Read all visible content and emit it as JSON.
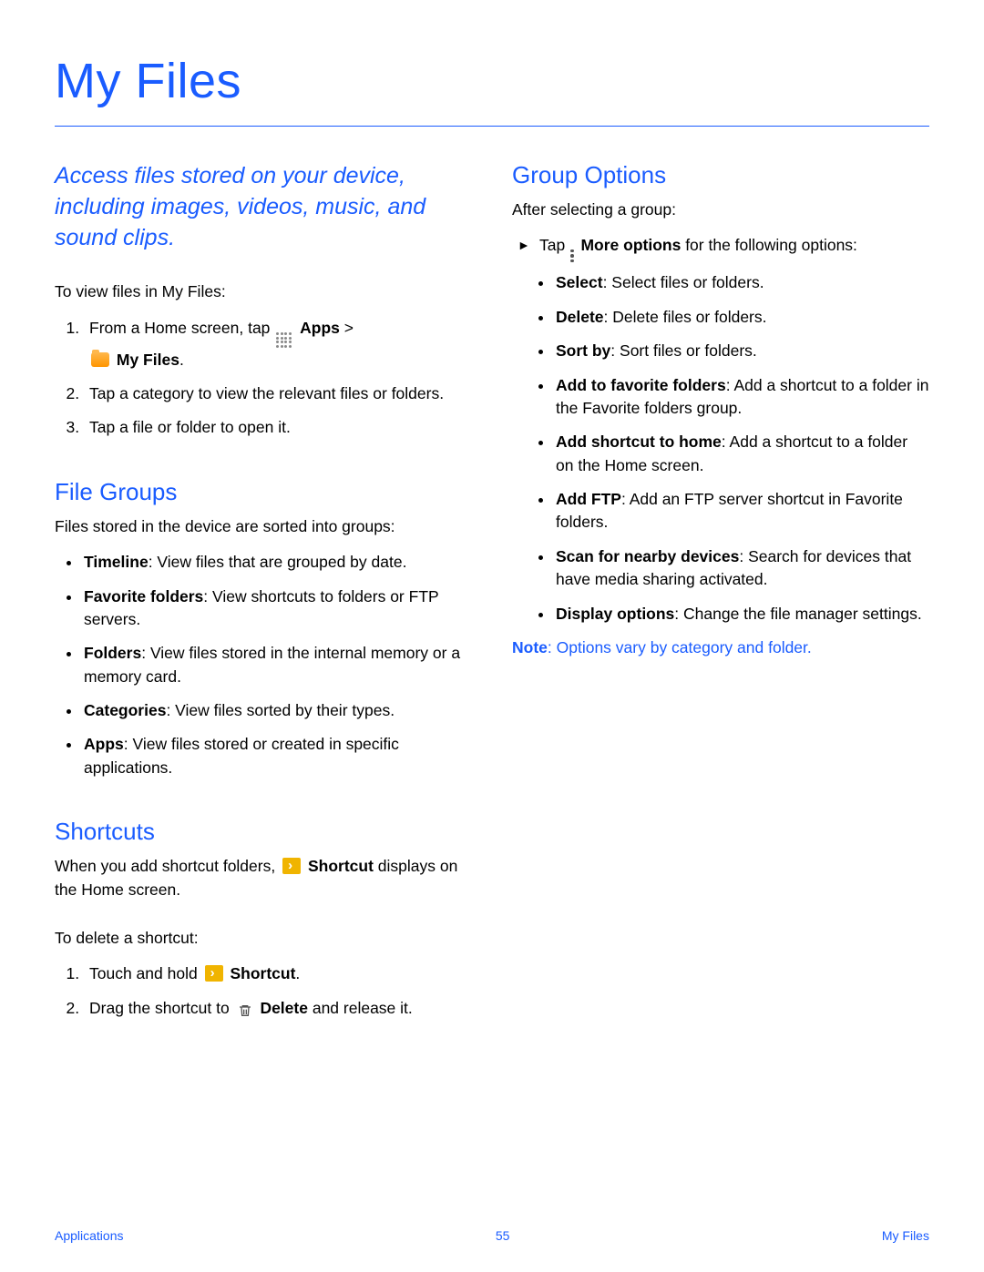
{
  "title": "My Files",
  "intro": "Access files stored on your device, including images, videos, music, and sound clips.",
  "viewFiles": {
    "lead": "To view files in My Files:",
    "step1_a": "From a Home screen, tap ",
    "step1_apps": "Apps",
    "step1_gt": " > ",
    "step1_myfiles": "My Files",
    "step1_end": ".",
    "step2": "Tap a category to view the relevant files or folders.",
    "step3": "Tap a file or folder to open it."
  },
  "fileGroups": {
    "heading": "File Groups",
    "lead": "Files stored in the device are sorted into groups:",
    "items": [
      {
        "term": "Timeline",
        "desc": ": View files that are grouped by date."
      },
      {
        "term": "Favorite folders",
        "desc": ": View shortcuts to folders or FTP servers."
      },
      {
        "term": "Folders",
        "desc": ": View files stored in the internal memory or a memory card."
      },
      {
        "term": "Categories",
        "desc": ": View files sorted by their types."
      },
      {
        "term": "Apps",
        "desc": ": View files stored or created in specific applications."
      }
    ]
  },
  "shortcuts": {
    "heading": "Shortcuts",
    "para_a": "When you add shortcut folders, ",
    "shortcut_label": "Shortcut",
    "para_b": " displays on the Home screen.",
    "deleteLead": "To delete a shortcut:",
    "step1_a": "Touch and hold ",
    "step1_b": "Shortcut",
    "step1_c": ".",
    "step2_a": "Drag the shortcut to ",
    "step2_b": "Delete",
    "step2_c": " and release it."
  },
  "groupOptions": {
    "heading": "Group Options",
    "lead": "After selecting a group:",
    "tap_a": "Tap ",
    "moreOptions": "More options",
    "tap_b": " for the following options:",
    "items": [
      {
        "term": "Select",
        "desc": ": Select files or folders."
      },
      {
        "term": "Delete",
        "desc": ": Delete files or folders."
      },
      {
        "term": "Sort by",
        "desc": ": Sort files or folders."
      },
      {
        "term": "Add to favorite folders",
        "desc": ": Add a shortcut to a folder in the Favorite folders group."
      },
      {
        "term": "Add shortcut to home",
        "desc": ": Add a shortcut to a folder on the Home screen."
      },
      {
        "term": "Add FTP",
        "desc": ": Add an FTP server shortcut in Favorite folders."
      },
      {
        "term": "Scan for nearby devices",
        "desc": ": Search for devices that have media sharing activated."
      },
      {
        "term": "Display options",
        "desc": ": Change the file manager settings."
      }
    ],
    "noteLabel": "Note",
    "noteText": ": Options vary by category and folder."
  },
  "footer": {
    "left": "Applications",
    "center": "55",
    "right": "My Files"
  }
}
